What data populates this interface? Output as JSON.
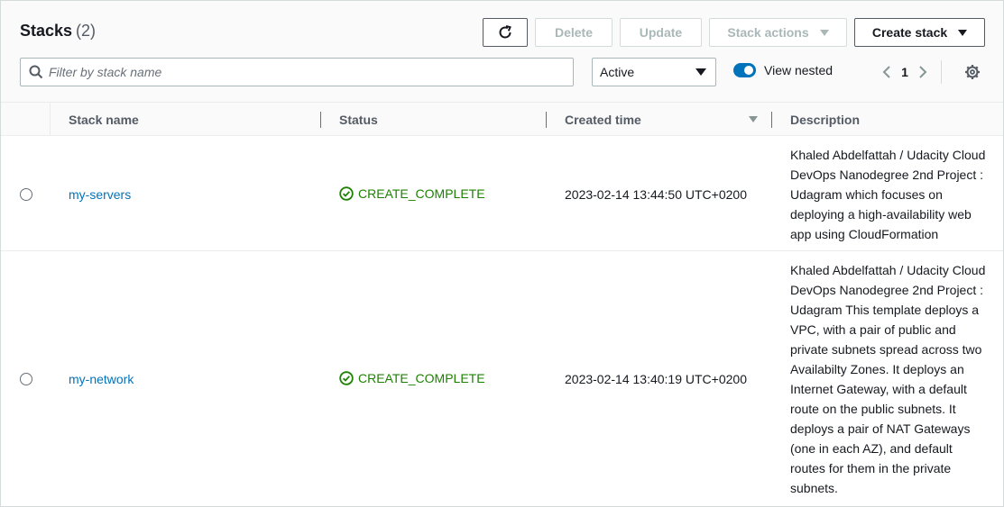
{
  "header": {
    "title": "Stacks",
    "count": "(2)",
    "buttons": {
      "delete": "Delete",
      "update": "Update",
      "stack_actions": "Stack actions",
      "create_stack": "Create stack"
    }
  },
  "filter": {
    "placeholder": "Filter by stack name",
    "value": "",
    "status_select": "Active",
    "view_nested_label": "View nested",
    "view_nested_on": true
  },
  "pagination": {
    "current_page": "1"
  },
  "table": {
    "columns": [
      "Stack name",
      "Status",
      "Created time",
      "Description"
    ],
    "rows": [
      {
        "name": "my-servers",
        "status": "CREATE_COMPLETE",
        "created": "2023-02-14 13:44:50 UTC+0200",
        "description": "Khaled Abdelfattah / Udacity Cloud DevOps Nanodegree 2nd Project : Udagram which focuses on deploying a high-availability web app using CloudFormation"
      },
      {
        "name": "my-network",
        "status": "CREATE_COMPLETE",
        "created": "2023-02-14 13:40:19 UTC+0200",
        "description": "Khaled Abdelfattah / Udacity Cloud DevOps Nanodegree 2nd Project : Udagram This template deploys a VPC, with a pair of public and private subnets spread across two Availabilty Zones. It deploys an Internet Gateway, with a default route on the public subnets. It deploys a pair of NAT Gateways (one in each AZ), and default routes for them in the private subnets."
      }
    ]
  },
  "colors": {
    "link": "#0073bb",
    "success": "#1d8102",
    "toggle_on": "#0073bb"
  },
  "icons": {
    "refresh": "refresh-icon",
    "search": "search-icon",
    "settings": "gear-icon",
    "status": "success-check-icon"
  }
}
